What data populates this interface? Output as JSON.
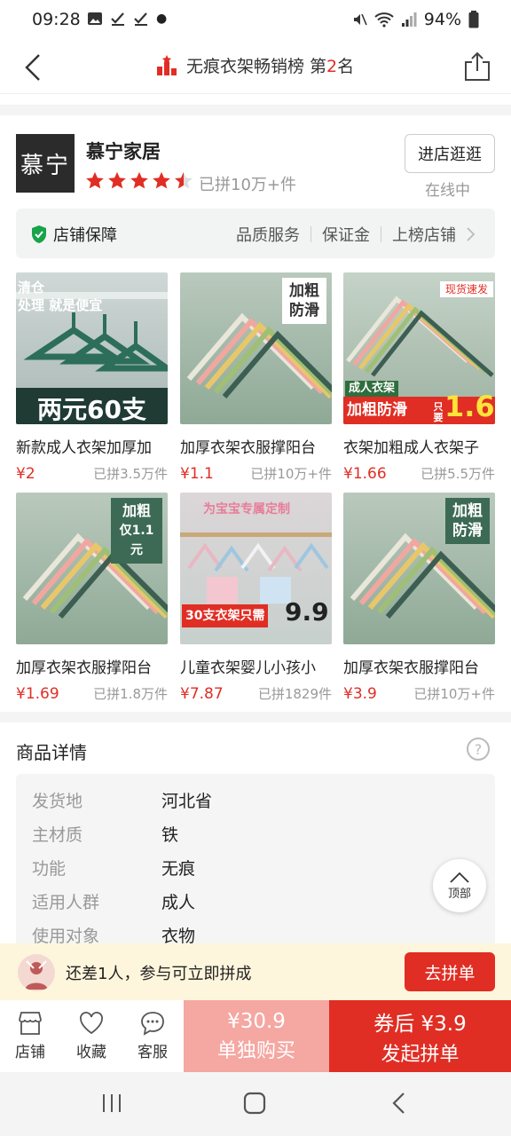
{
  "status_bar": {
    "time": "09:28",
    "battery": "94%"
  },
  "header": {
    "title_prefix": "无痕衣架畅销榜 第",
    "rank": "2",
    "title_suffix": "名"
  },
  "shop": {
    "logo_text": "慕宁",
    "name": "慕宁家居",
    "rating_stars": 4.5,
    "sold": "已拼10万+件",
    "visit_label": "进店逛逛",
    "online": "在线中",
    "guarantee_label": "店铺保障",
    "guarantee_items": [
      "品质服务",
      "保证金",
      "上榜店铺"
    ]
  },
  "products": [
    {
      "name": "新款成人衣架加厚加",
      "price": "¥2",
      "sold": "已拼3.5万件",
      "img_text_1": "清仓",
      "img_text_2": "处理 就是便宜",
      "img_text_3": "两元60支"
    },
    {
      "name": "加厚衣架衣服撑阳台",
      "price": "¥1.1",
      "sold": "已拼10万+件",
      "img_tag_1": "加粗",
      "img_tag_2": "防滑"
    },
    {
      "name": "衣架加粗成人衣架子",
      "price": "¥1.66",
      "sold": "已拼5.5万件",
      "img_tag_1": "现货速发",
      "img_tag_2": "成人衣架",
      "img_tag_3": "加粗防滑",
      "img_tag_4": "只要",
      "img_tag_5": "1.6"
    },
    {
      "name": "加厚衣架衣服撑阳台",
      "price": "¥1.69",
      "sold": "已拼1.8万件",
      "img_tag_1": "加粗",
      "img_tag_2": "仅1.1元"
    },
    {
      "name": "儿童衣架婴儿小孩小",
      "price": "¥7.87",
      "sold": "已拼1829件",
      "img_tag_1": "为宝宝专属定制",
      "img_tag_2": "30支衣架只需",
      "img_tag_3": "9.9"
    },
    {
      "name": "加厚衣架衣服撑阳台",
      "price": "¥3.9",
      "sold": "已拼10万+件",
      "img_tag_1": "加粗",
      "img_tag_2": "防滑"
    }
  ],
  "details": {
    "title": "商品详情",
    "rows": [
      {
        "k": "发货地",
        "v": "河北省"
      },
      {
        "k": "主材质",
        "v": "铁"
      },
      {
        "k": "功能",
        "v": "无痕"
      },
      {
        "k": "适用人群",
        "v": "成人"
      },
      {
        "k": "使用对象",
        "v": "衣物"
      }
    ]
  },
  "top_button": "顶部",
  "group_bar": {
    "text": "还差1人，参与可立即拼成",
    "button": "去拼单"
  },
  "actions": {
    "store": "店铺",
    "favorite": "收藏",
    "service": "客服",
    "single_price": "¥30.9",
    "single_label": "单独购买",
    "group_price": "券后 ¥3.9",
    "group_label": "发起拼单"
  },
  "colors": {
    "accent": "#e02e24",
    "single_buy": "#f5a7a2",
    "group_bar_bg": "#fef6dc"
  }
}
